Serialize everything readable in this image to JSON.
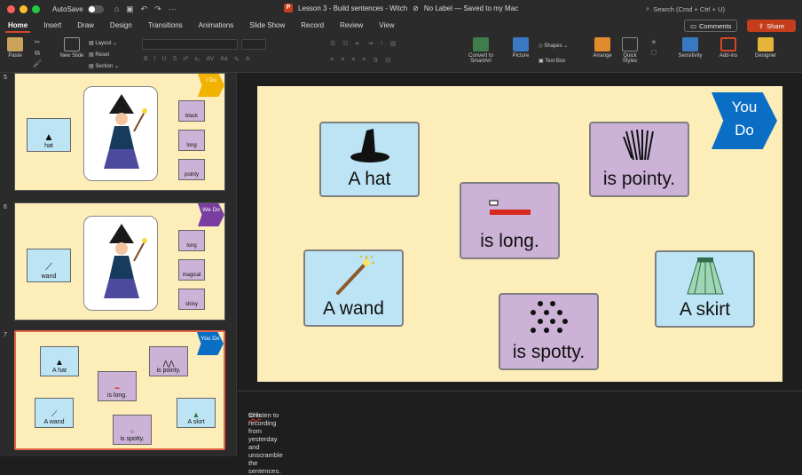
{
  "titlebar": {
    "autosave_label": "AutoSave",
    "doc_title": "Lesson 3 - Build sentences - Witch",
    "label_status": "No Label — Saved to my Mac",
    "search_placeholder": "Search (Cmd + Ctrl + U)"
  },
  "tabs": [
    "Home",
    "Insert",
    "Draw",
    "Design",
    "Transitions",
    "Animations",
    "Slide Show",
    "Record",
    "Review",
    "View"
  ],
  "header_buttons": {
    "comments": "Comments",
    "share": "Share"
  },
  "ribbon": {
    "paste": "Paste",
    "new_slide": "New Slide",
    "layout": "Layout",
    "reset": "Reset",
    "section": "Section",
    "convert": "Convert to SmartArt",
    "picture": "Picture",
    "shapes": "Shapes",
    "text_box": "Text Box",
    "arrange": "Arrange",
    "quick_styles": "Quick Styles",
    "sensitivity": "Sensitivity",
    "addins": "Add-ins",
    "designer": "Designer"
  },
  "thumbnails": [
    {
      "number": "5",
      "tag": "I Do",
      "tag_color": "#f2b200",
      "main": "hat",
      "words": [
        "black",
        "long",
        "pointy"
      ]
    },
    {
      "number": "6",
      "tag": "We Do",
      "tag_color": "#7a3ea1",
      "main": "wand",
      "words": [
        "long",
        "magical",
        "shiny"
      ]
    },
    {
      "number": "7",
      "tag": "You Do",
      "tag_color": "#0b6ec5",
      "cards": [
        "A hat",
        "is pointy.",
        "is long.",
        "A wand",
        "A skirt",
        "is spotty."
      ]
    }
  ],
  "slide": {
    "tag_line1": "You",
    "tag_line2": "Do",
    "cards": {
      "hat": "A hat",
      "pointy": "is pointy.",
      "long": "is long.",
      "wand": "A wand",
      "skirt": "A skirt",
      "spotty": "is spotty."
    }
  },
  "notes": {
    "prefix": "Chn",
    "text": " to listen to recording from yesterday and unscramble the sentences."
  },
  "colors": {
    "slide_bg": "#fcedb9",
    "card_blue": "#bde4f5",
    "card_purple": "#cbb2d6",
    "you_do": "#0b6ec5",
    "share": "#c43e1c"
  }
}
